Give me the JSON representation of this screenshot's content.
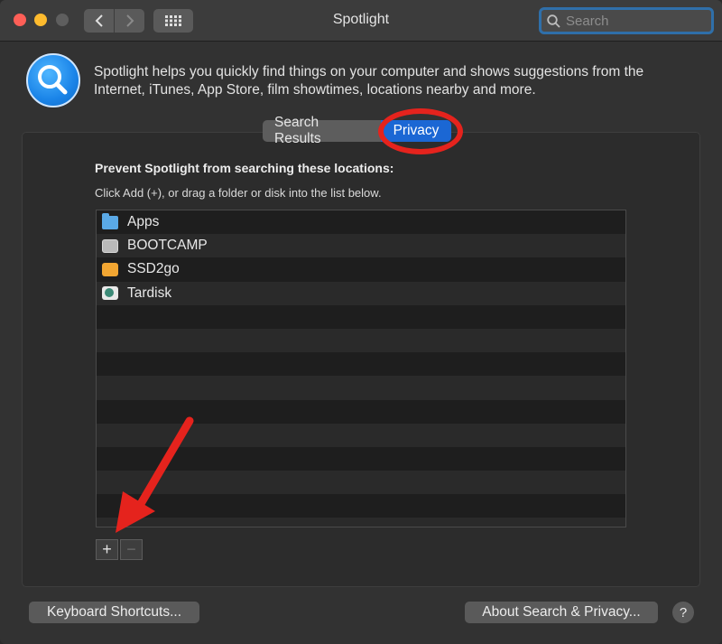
{
  "window": {
    "title": "Spotlight",
    "search_placeholder": "Search"
  },
  "header": {
    "description": "Spotlight helps you quickly find things on your computer and shows suggestions from the Internet, iTunes, App Store, film showtimes, locations nearby and more."
  },
  "tabs": [
    {
      "label": "Search Results",
      "selected": false
    },
    {
      "label": "Privacy",
      "selected": true
    }
  ],
  "privacy": {
    "heading": "Prevent Spotlight from searching these locations:",
    "subheading": "Click Add (+), or drag a folder or disk into the list below.",
    "locations": [
      {
        "name": "Apps",
        "icon": "folder-icon"
      },
      {
        "name": "BOOTCAMP",
        "icon": "internal-disk-icon"
      },
      {
        "name": "SSD2go",
        "icon": "external-disk-icon"
      },
      {
        "name": "Tardisk",
        "icon": "time-machine-disk-icon"
      }
    ],
    "add_label": "+",
    "remove_label": "−"
  },
  "footer": {
    "keyboard_shortcuts_label": "Keyboard Shortcuts...",
    "about_label": "About Search & Privacy...",
    "help_label": "?"
  },
  "colors": {
    "accent": "#1b67d4",
    "annotation_red": "#e5231d"
  }
}
